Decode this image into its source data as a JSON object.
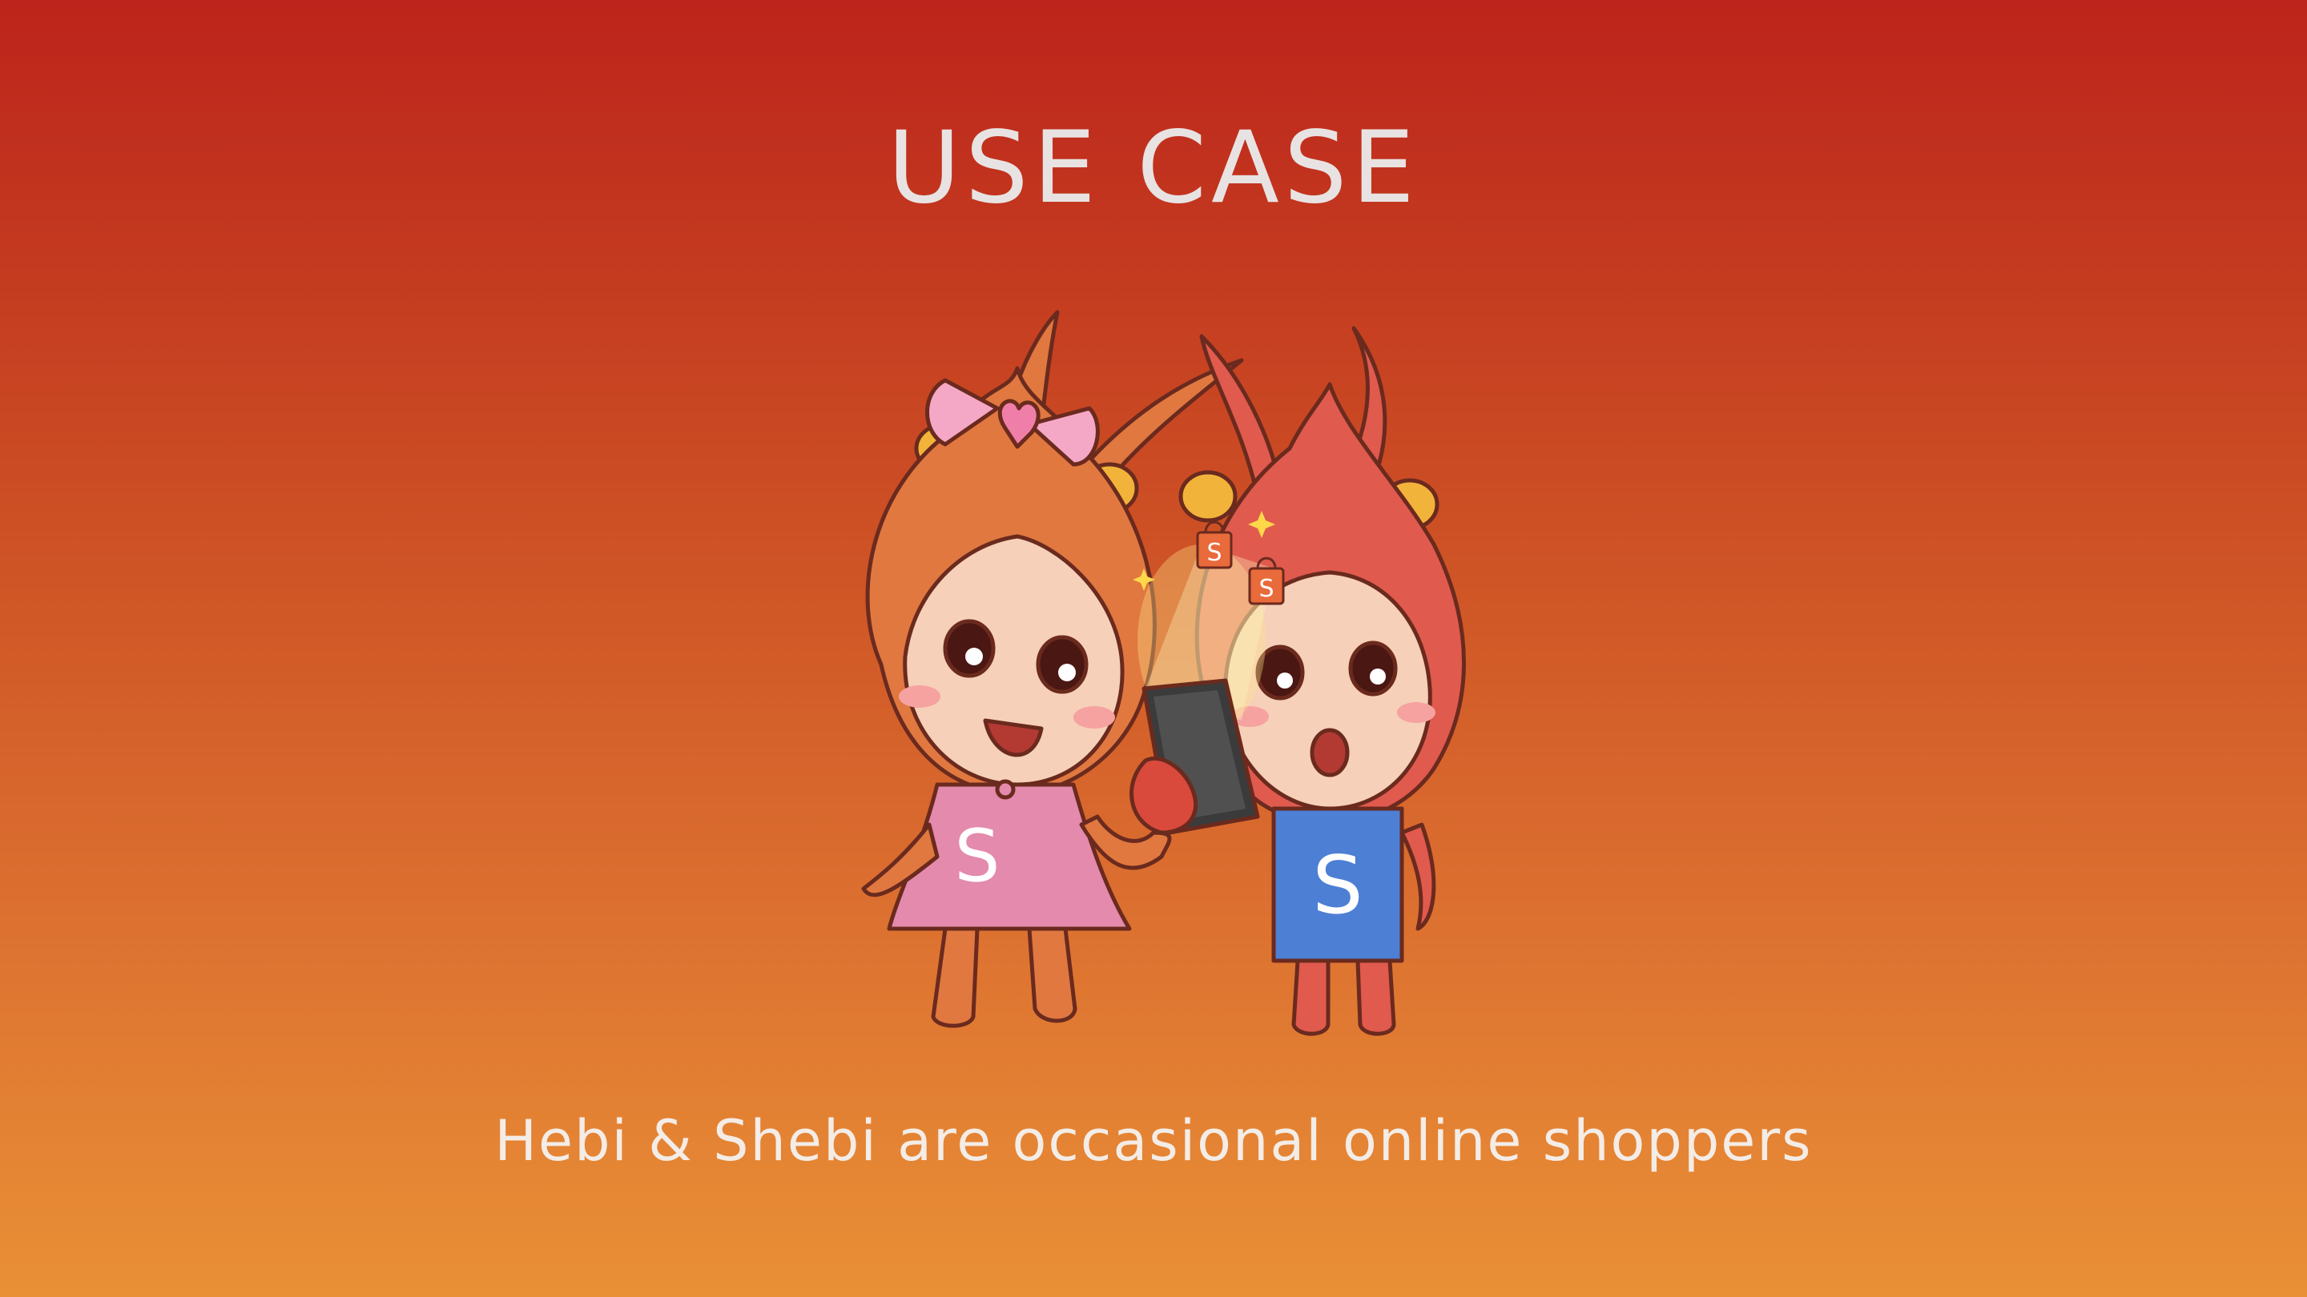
{
  "slide": {
    "title": "USE CASE",
    "caption": "Hebi & Shebi are occasional online shoppers"
  },
  "illustration": {
    "girl_shirt_letter": "S",
    "boy_shirt_letter": "S",
    "bag_letter": "S"
  },
  "colors": {
    "background_top": "#bd241b",
    "background_bottom": "#e99036",
    "title_text": "#e8e3e2",
    "girl_head": "#e07840",
    "boy_head": "#e05a4e",
    "girl_dress": "#e48aac",
    "boy_shirt": "#4d7fd4",
    "outline": "#6b2a1e"
  }
}
